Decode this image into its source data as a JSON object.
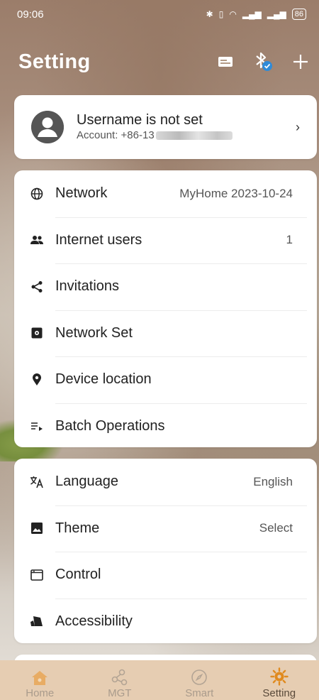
{
  "status_bar": {
    "time": "09:06",
    "battery": "86"
  },
  "header": {
    "title": "Setting"
  },
  "user": {
    "name": "Username is not set",
    "account_prefix": "Account: +86-13"
  },
  "group1": [
    {
      "label": "Network",
      "value": "MyHome 2023-10-24",
      "icon": "globe-icon"
    },
    {
      "label": "Internet users",
      "value": "1",
      "icon": "users-icon"
    },
    {
      "label": "Invitations",
      "value": "",
      "icon": "share-icon"
    },
    {
      "label": "Network Set",
      "value": "",
      "icon": "network-set-icon"
    },
    {
      "label": "Device location",
      "value": "",
      "icon": "location-pin-icon"
    },
    {
      "label": "Batch Operations",
      "value": "",
      "icon": "batch-list-icon"
    }
  ],
  "group2": [
    {
      "label": "Language",
      "value": "English",
      "icon": "translate-icon"
    },
    {
      "label": "Theme",
      "value": "Select",
      "icon": "image-icon"
    },
    {
      "label": "Control",
      "value": "",
      "icon": "window-icon"
    },
    {
      "label": "Accessibility",
      "value": "",
      "icon": "accessibility-icon"
    }
  ],
  "bottom_nav": [
    {
      "label": "Home",
      "icon": "home-icon",
      "active": false
    },
    {
      "label": "MGT",
      "icon": "nodes-icon",
      "active": false
    },
    {
      "label": "Smart",
      "icon": "compass-icon",
      "active": false
    },
    {
      "label": "Setting",
      "icon": "gear-icon",
      "active": true
    }
  ],
  "colors": {
    "nav_bg": "#e6cdb2",
    "nav_active_icon": "#e08a1e",
    "nav_inactive": "#a99b8c",
    "bluetooth_badge": "#2f8bd8"
  }
}
